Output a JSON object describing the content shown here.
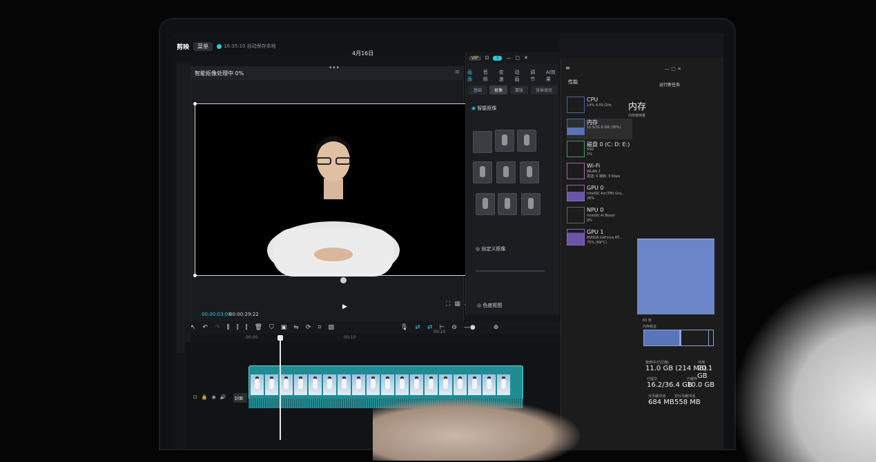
{
  "editor": {
    "app_name": "剪映",
    "menu_label": "菜单",
    "autosave_text": "16:35:10 自动保存本地",
    "project_title": "4月16日",
    "processing_text": "智能抠像处理中 0%",
    "time_current": "00:00:03:08",
    "time_total": "00:00:29:22",
    "cover_label": "封面",
    "ruler_ticks": [
      "00:00",
      "00:10",
      "00:20"
    ],
    "inspector": {
      "tabs": [
        "画面",
        "音频",
        "变速",
        "动画",
        "调节",
        "AI效果"
      ],
      "sub_tabs": [
        "基础",
        "抠像",
        "蒙版",
        "背景填充"
      ],
      "active_tab": "画面",
      "active_sub_tab": "抠像",
      "smart_cutout_label": "智能抠像",
      "custom_cutout_label": "自定义抠像",
      "chroma_cutout_label": "色度抠图"
    },
    "accent_color": "#2fc7e0"
  },
  "task_manager": {
    "title": "性能",
    "run_task_label": "运行新任务",
    "items": [
      {
        "name": "CPU",
        "sub": "14% 4.09 GHz"
      },
      {
        "name": "内存",
        "sub": "11.5/31.6 GB (36%)"
      },
      {
        "name": "磁盘 0 (C: D: E:)",
        "sub": "SSD\n1%"
      },
      {
        "name": "Wi-Fi",
        "sub": "WLAN 2\n发送: 0 接收: 0 Kbps"
      },
      {
        "name": "GPU 0",
        "sub": "Intel(R) Arc(TM) Gra...\n28%"
      },
      {
        "name": "NPU 0",
        "sub": "Intel(R) AI Boost\n0%"
      },
      {
        "name": "GPU 1",
        "sub": "NVIDIA GeForce RT...\n75% (69°C)"
      }
    ],
    "memory_heading": "内存",
    "memory_usage_label": "内存使用量",
    "graph_time_label": "60 秒",
    "composition_label": "内存组合",
    "stats": {
      "in_use_label": "使用中(已压缩)",
      "in_use": "11.0 GB (214 MB)",
      "available_label": "可用",
      "available": "20.1 GB",
      "committed_label": "已提交",
      "committed": "16.2/36.4 GB",
      "cached_label": "已缓存",
      "cached": "10.0 GB",
      "paged_pool_label": "分页缓冲池",
      "paged_pool": "684 MB",
      "nonpaged_pool_label": "非分页缓冲池",
      "nonpaged_pool": "558 MB"
    },
    "graph_color": "#6c85c8"
  }
}
